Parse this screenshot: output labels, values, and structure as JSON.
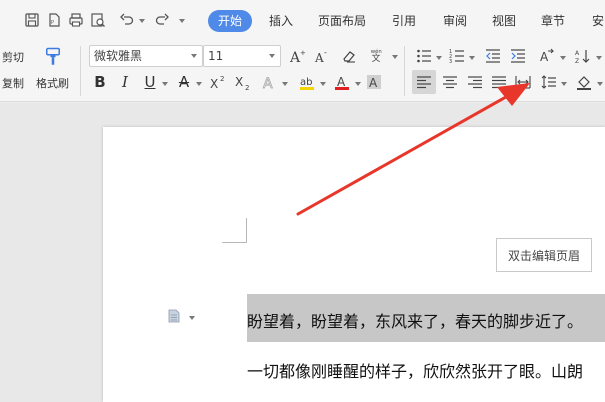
{
  "menu": {
    "tabs": [
      {
        "label": "开始"
      },
      {
        "label": "插入"
      },
      {
        "label": "页面布局"
      },
      {
        "label": "引用"
      },
      {
        "label": "审阅"
      },
      {
        "label": "视图"
      },
      {
        "label": "章节"
      },
      {
        "label": "安"
      }
    ]
  },
  "ribbon": {
    "cut_label": "剪切",
    "copy_label": "复制",
    "format_painter_label": "格式刷",
    "font_name": "微软雅黑",
    "font_size": "11",
    "phonetic_glyph": "wén"
  },
  "document": {
    "header_button_label": "双击编辑页眉",
    "line1": "盼望着，盼望着，东风来了，春天的脚步近了。",
    "line2": "一切都像刚睡醒的样子，欣欣然张开了眼。山朗"
  },
  "colors": {
    "active_tab": "#4f8ae8",
    "arrow": "#e8362b",
    "selection": "#c7c7c7",
    "font_color_underline": "#e02020",
    "highlight_underline": "#f5d500"
  }
}
